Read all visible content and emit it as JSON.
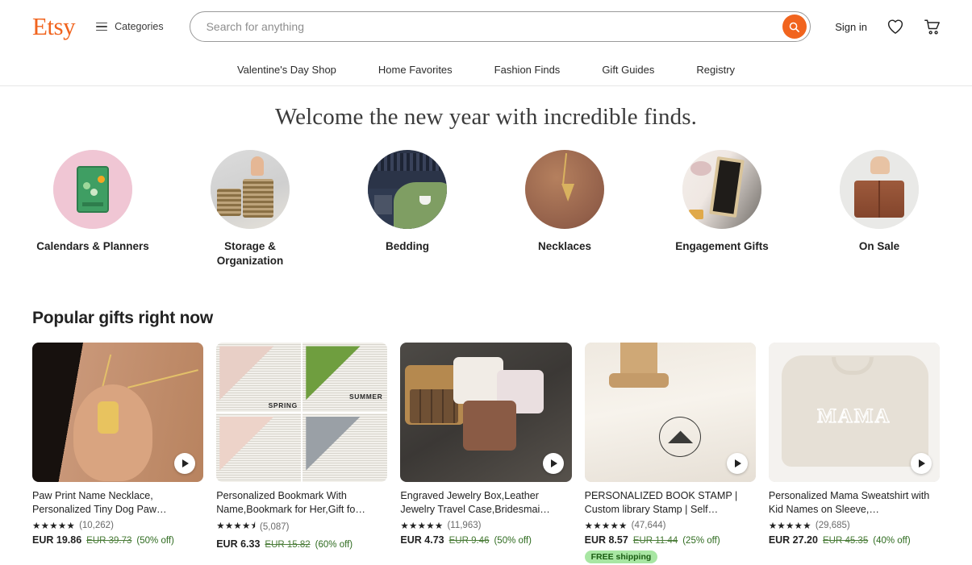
{
  "header": {
    "logo": "Etsy",
    "categories_label": "Categories",
    "search_placeholder": "Search for anything",
    "search_value": "",
    "signin_label": "Sign in",
    "favorites_icon": "heart-icon",
    "cart_icon": "cart-icon",
    "search_icon": "search-icon"
  },
  "nav": {
    "items": [
      {
        "label": "Valentine's Day Shop"
      },
      {
        "label": "Home Favorites"
      },
      {
        "label": "Fashion Finds"
      },
      {
        "label": "Gift Guides"
      },
      {
        "label": "Registry"
      }
    ]
  },
  "hero": {
    "title": "Welcome the new year with incredible finds."
  },
  "categories": [
    {
      "label": "Calendars & Planners"
    },
    {
      "label": "Storage & Organization"
    },
    {
      "label": "Bedding"
    },
    {
      "label": "Necklaces"
    },
    {
      "label": "Engagement Gifts"
    },
    {
      "label": "On Sale"
    }
  ],
  "popular": {
    "section_title": "Popular gifts right now",
    "products": [
      {
        "title": "Paw Print Name Necklace, Personalized Tiny Dog Paw…",
        "stars": "★★★★★",
        "reviews": "(10,262)",
        "price": "EUR 19.86",
        "old_price": "EUR 39.73",
        "discount": "(50% off)",
        "free_shipping": "",
        "has_video": true
      },
      {
        "title": "Personalized Bookmark With Name,Bookmark for Her,Gift fo…",
        "stars": "★★★★⯨",
        "reviews": "(5,087)",
        "price": "EUR 6.33",
        "old_price": "EUR 15.82",
        "discount": "(60% off)",
        "free_shipping": "",
        "has_video": false,
        "tile_labels": [
          "SPRING",
          "SUMMER"
        ]
      },
      {
        "title": "Engraved Jewelry Box,Leather Jewelry Travel Case,Bridesmai…",
        "stars": "★★★★★",
        "reviews": "(11,963)",
        "price": "EUR 4.73",
        "old_price": "EUR 9.46",
        "discount": "(50% off)",
        "free_shipping": "",
        "has_video": true
      },
      {
        "title": "PERSONALIZED BOOK STAMP | Custom library Stamp | Self…",
        "stars": "★★★★★",
        "reviews": "(47,644)",
        "price": "EUR 8.57",
        "old_price": "EUR 11.44",
        "discount": "(25% off)",
        "free_shipping": "FREE shipping",
        "has_video": true
      },
      {
        "title": "Personalized Mama Sweatshirt with Kid Names on Sleeve,…",
        "stars": "★★★★★",
        "reviews": "(29,685)",
        "price": "EUR 27.20",
        "old_price": "EUR 45.35",
        "discount": "(40% off)",
        "free_shipping": "",
        "has_video": true,
        "graphic_text": "MAMA"
      }
    ]
  },
  "colors": {
    "brand_orange": "#F1641E",
    "sale_green": "#2e6b1f",
    "free_ship_bg": "#a8e6a3"
  }
}
